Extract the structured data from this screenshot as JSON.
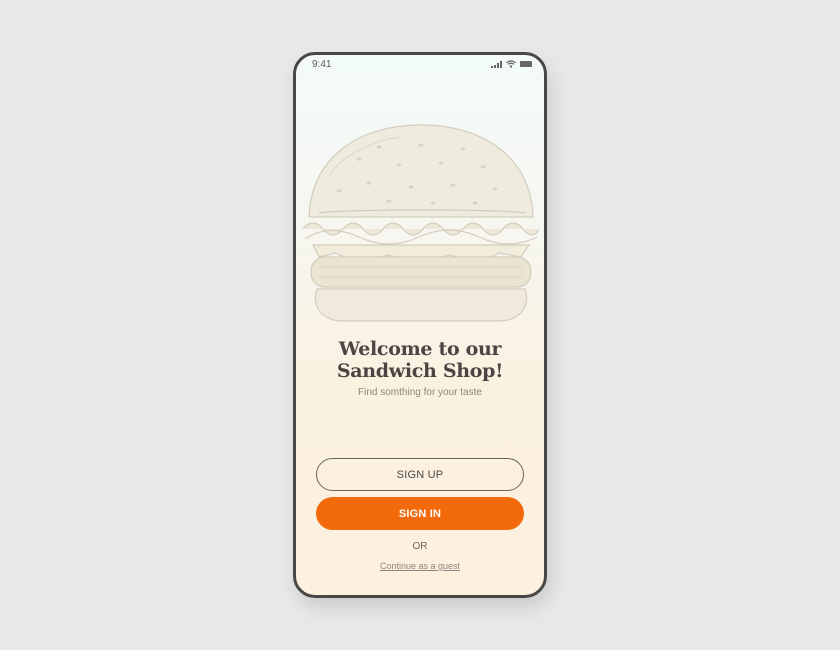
{
  "status_bar": {
    "time": "9:41",
    "icons": [
      "signal-icon",
      "wifi-icon",
      "battery-icon"
    ]
  },
  "hero": {
    "illustration": "burger-illustration",
    "title_line1": "Welcome to our",
    "title_line2": "Sandwich Shop!",
    "subtitle": "Find somthing for your taste"
  },
  "actions": {
    "sign_up_label": "SIGN UP",
    "sign_in_label": "SIGN IN",
    "or_label": "OR",
    "guest_label": "Continue as a guest"
  },
  "colors": {
    "accent": "#f26a0c",
    "frame": "#474747",
    "text": "#4b4443"
  }
}
